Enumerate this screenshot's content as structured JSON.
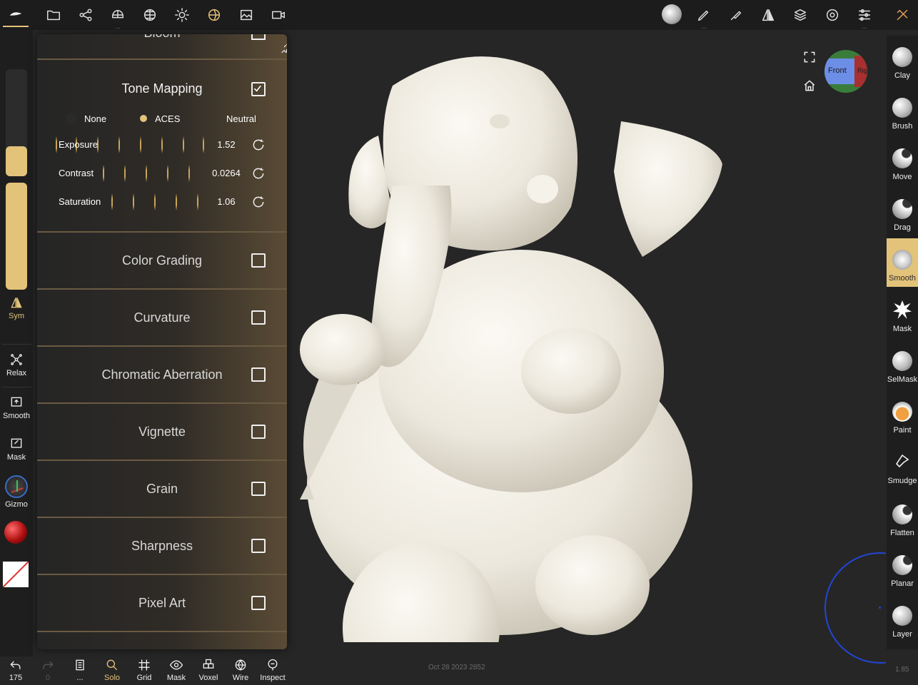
{
  "top_toolbar": {
    "left_icons": [
      "app-logo-icon",
      "folder-icon",
      "scene-tree-icon",
      "mesh-icon",
      "topology-icon",
      "light-icon",
      "material-icon",
      "image-icon",
      "video-icon"
    ],
    "right_icons": [
      "brush-preview-icon",
      "paint-icon",
      "stroke-icon",
      "symmetry-icon",
      "layers-icon",
      "settings-icon",
      "sliders-icon",
      "tools-icon"
    ]
  },
  "left_sidebar": {
    "sym_label": "Sym",
    "relax_label": "Relax",
    "smooth_label": "Smooth",
    "mask_label": "Mask",
    "gizmo_label": "Gizmo"
  },
  "postprocess_panel": {
    "top_partial_label": "Bloom",
    "tone_mapping": {
      "title": "Tone Mapping",
      "checked": true,
      "modes": [
        "None",
        "ACES",
        "Neutral"
      ],
      "selected_mode": "ACES",
      "sliders": [
        {
          "label": "Exposure",
          "value": "1.52"
        },
        {
          "label": "Contrast",
          "value": "0.0264"
        },
        {
          "label": "Saturation",
          "value": "1.06"
        }
      ]
    },
    "sections": [
      {
        "title": "Color Grading",
        "checked": false
      },
      {
        "title": "Curvature",
        "checked": false
      },
      {
        "title": "Chromatic Aberration",
        "checked": false
      },
      {
        "title": "Vignette",
        "checked": false
      },
      {
        "title": "Grain",
        "checked": false
      },
      {
        "title": "Sharpness",
        "checked": false
      },
      {
        "title": "Pixel Art",
        "checked": false
      }
    ]
  },
  "view_cube": {
    "front_label": "Front",
    "right_label": "Rig"
  },
  "tools": [
    {
      "label": "Clay"
    },
    {
      "label": "Brush"
    },
    {
      "label": "Move"
    },
    {
      "label": "Drag"
    },
    {
      "label": "Smooth",
      "selected": true
    },
    {
      "label": "Mask"
    },
    {
      "label": "SelMask"
    },
    {
      "label": "Paint"
    },
    {
      "label": "Smudge"
    },
    {
      "label": "Flatten"
    },
    {
      "label": "Planar"
    },
    {
      "label": "Layer"
    }
  ],
  "bottom_toolbar": {
    "undo_count": "175",
    "redo_count": "0",
    "buttons": [
      {
        "label": "...",
        "name": "history"
      },
      {
        "label": "Solo",
        "active": true
      },
      {
        "label": "Grid"
      },
      {
        "label": "Mask"
      },
      {
        "label": "Voxel"
      },
      {
        "label": "Wire"
      },
      {
        "label": "Inspect"
      }
    ]
  },
  "watermark": "Oct 28 2023 2852",
  "zoom_readout": "1.85",
  "colors": {
    "accent": "#e3c37a",
    "panel_border": "#6a5a42",
    "model": "#efece4",
    "background": "#262626"
  }
}
